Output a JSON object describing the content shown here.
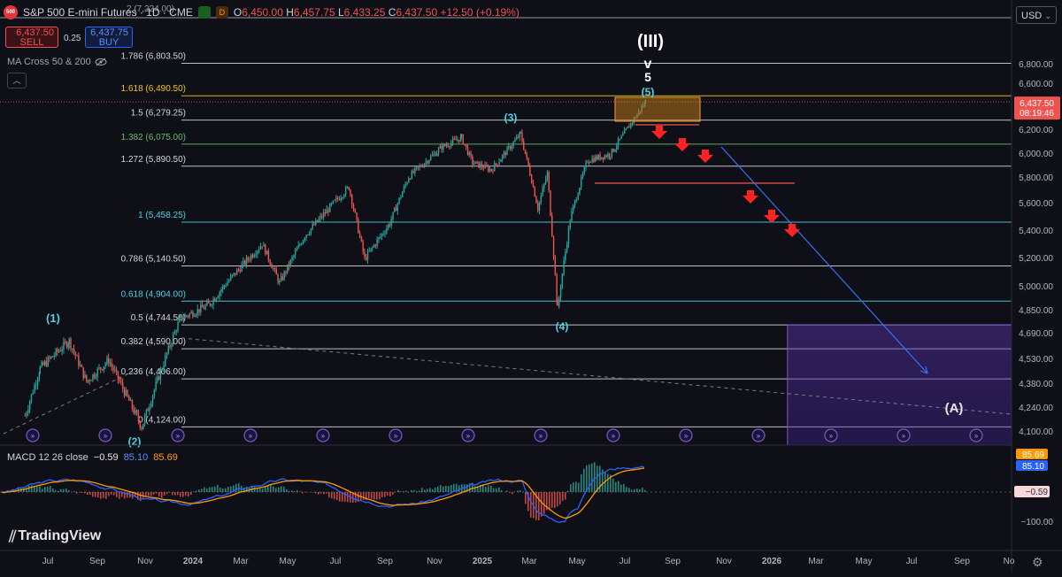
{
  "header": {
    "logo_text": "500",
    "title": "S&P 500 E-mini Futures · 1D · CME",
    "badge1": "",
    "badge2": "D",
    "open_k": "O",
    "open": "6,450.00",
    "high_k": "H",
    "high": "6,457.75",
    "low_k": "L",
    "low": "6,433.25",
    "close_k": "C",
    "close": "6,437.50",
    "change": "+12.50 (+0.19%)"
  },
  "trade": {
    "sell_price": "6,437.50",
    "sell_label": "SELL",
    "buy_price": "6,437.75",
    "buy_label": "BUY",
    "spread": "0.25"
  },
  "indicator": {
    "label": "MA Cross 50 & 200",
    "eye_icon": "eye-off-icon",
    "collapse_icon": "chevron-up-icon"
  },
  "currency": "USD",
  "macd": {
    "label": "MACD 12 26 close",
    "hist": "−0.59",
    "macd": "85.10",
    "signal": "85.69",
    "tag_signal": "85.69",
    "tag_macd": "85.10",
    "tag_hist": "−0.59",
    "axis": "−100.00"
  },
  "branding": "TradingView",
  "colors": {
    "bg": "#0f0f17",
    "up": "#26a69a",
    "down": "#ef5350",
    "fib_gold": "#f0c419",
    "teal": "#4dd0e1",
    "green": "#66bb6a",
    "arrow": "#ff2222",
    "box": "#7e57c2",
    "macd": "#2962ff",
    "signal": "#ff9800"
  },
  "chart_data": {
    "type": "candlestick",
    "price_axis": {
      "ticks": [
        "6,800.00",
        "6,600.00",
        "6,400.00",
        "6,200.00",
        "6,000.00",
        "5,800.00",
        "5,600.00",
        "5,400.00",
        "5,200.00",
        "5,000.00",
        "4,850.00",
        "4,690.00",
        "4,530.00",
        "4,380.00",
        "4,240.00",
        "4,100.00"
      ],
      "current_price": "6,437.50",
      "countdown": "08:19:46"
    },
    "time_axis": {
      "ticks": [
        "Jul",
        "Sep",
        "Nov",
        "2024",
        "Mar",
        "May",
        "Jul",
        "Sep",
        "Nov",
        "2025",
        "Mar",
        "May",
        "Jul",
        "Sep",
        "Nov",
        "2026",
        "Mar",
        "May",
        "Jul",
        "Sep",
        "No"
      ]
    },
    "fib_levels": [
      {
        "ratio": "2",
        "label": "2 (7,224.00)",
        "price": 7224,
        "color": "#9598a1"
      },
      {
        "ratio": "1.786",
        "label": "1.786 (6,803.50)",
        "price": 6803.5,
        "color": "#d1d4dc"
      },
      {
        "ratio": "1.618",
        "label": "1.618 (6,490.50)",
        "price": 6490.5,
        "color": "#f0c419"
      },
      {
        "ratio": "1.5",
        "label": "1.5 (6,279.25)",
        "price": 6279.25,
        "color": "#d1d4dc"
      },
      {
        "ratio": "1.382",
        "label": "1.382 (6,075.00)",
        "price": 6075,
        "color": "#66bb6a"
      },
      {
        "ratio": "1.272",
        "label": "1.272 (5,890.50)",
        "price": 5890.5,
        "color": "#d1d4dc"
      },
      {
        "ratio": "1",
        "label": "1 (5,458.25)",
        "price": 5458.25,
        "color": "#4dd0e1"
      },
      {
        "ratio": "0.786",
        "label": "0.786 (5,140.50)",
        "price": 5140.5,
        "color": "#d1d4dc"
      },
      {
        "ratio": "0.618",
        "label": "0.618 (4,904.00)",
        "price": 4904,
        "color": "#4dd0e1"
      },
      {
        "ratio": "0.5",
        "label": "0.5 (4,744.50)",
        "price": 4744.5,
        "color": "#d1d4dc"
      },
      {
        "ratio": "0.382",
        "label": "0.382 (4,590.00)",
        "price": 4590,
        "color": "#d1d4dc"
      },
      {
        "ratio": "0.236",
        "label": "0.236 (4,406.00)",
        "price": 4406,
        "color": "#d1d4dc"
      },
      {
        "ratio": "0",
        "label": "0 (4,124.00)",
        "price": 4124,
        "color": "#d1d4dc"
      }
    ],
    "wave_labels": [
      {
        "text": "(1)",
        "date": "2023-07-27",
        "color": "#4dd0e1"
      },
      {
        "text": "(2)",
        "date": "2023-10-27",
        "color": "#4dd0e1"
      },
      {
        "text": "(3)",
        "date": "2025-02-19",
        "color": "#4dd0e1"
      },
      {
        "text": "(4)",
        "date": "2025-04-07",
        "color": "#4dd0e1"
      },
      {
        "text": "(5)",
        "date": "2025-07-28",
        "color": "#4dd0e1"
      },
      {
        "text": "5",
        "date": "2025-07-28",
        "color": "#ffffff"
      },
      {
        "text": "v",
        "date": "2025-07-28",
        "color": "#ffffff"
      },
      {
        "text": "(III)",
        "date": "2025-07-28",
        "color": "#ffffff"
      },
      {
        "text": "(A)",
        "date": "2026-07-30",
        "color": "#ffffff"
      }
    ],
    "series": [
      {
        "name": "",
        "points": [
          {
            "date": "2023-06-01",
            "close": 4190
          },
          {
            "date": "2023-06-20",
            "close": 4470
          },
          {
            "date": "2023-07-27",
            "close": 4640
          },
          {
            "date": "2023-08-18",
            "close": 4390
          },
          {
            "date": "2023-09-15",
            "close": 4520
          },
          {
            "date": "2023-10-27",
            "close": 4124
          },
          {
            "date": "2023-12-15",
            "close": 4790
          },
          {
            "date": "2024-01-20",
            "close": 4880
          },
          {
            "date": "2024-03-28",
            "close": 5300
          },
          {
            "date": "2024-04-19",
            "close": 5020
          },
          {
            "date": "2024-05-21",
            "close": 5360
          },
          {
            "date": "2024-07-16",
            "close": 5720
          },
          {
            "date": "2024-08-05",
            "close": 5190
          },
          {
            "date": "2024-09-06",
            "close": 5450
          },
          {
            "date": "2024-09-30",
            "close": 5800
          },
          {
            "date": "2024-11-11",
            "close": 6050
          },
          {
            "date": "2024-12-06",
            "close": 6130
          },
          {
            "date": "2024-12-20",
            "close": 5920
          },
          {
            "date": "2025-01-13",
            "close": 5860
          },
          {
            "date": "2025-02-19",
            "close": 6160
          },
          {
            "date": "2025-03-13",
            "close": 5560
          },
          {
            "date": "2025-03-25",
            "close": 5830
          },
          {
            "date": "2025-04-07",
            "close": 4850
          },
          {
            "date": "2025-04-23",
            "close": 5480
          },
          {
            "date": "2025-05-15",
            "close": 5940
          },
          {
            "date": "2025-06-13",
            "close": 5990
          },
          {
            "date": "2025-07-28",
            "close": 6437.5
          }
        ]
      }
    ],
    "projection": {
      "arrows": [
        "2025-08-25",
        "2025-09-20",
        "2025-10-10",
        "2025-11-20",
        "2025-12-15",
        "2026-01-10"
      ],
      "line_from": {
        "date": "2025-10-20",
        "price": 6080
      },
      "line_to": {
        "date": "2026-07-20",
        "price": 4430
      },
      "target_zone": {
        "from_date": "2026-01-24",
        "to_date": "2026-12-31",
        "top": 4744.5,
        "bottom": 4124
      }
    },
    "grid": false,
    "legend": "none"
  }
}
